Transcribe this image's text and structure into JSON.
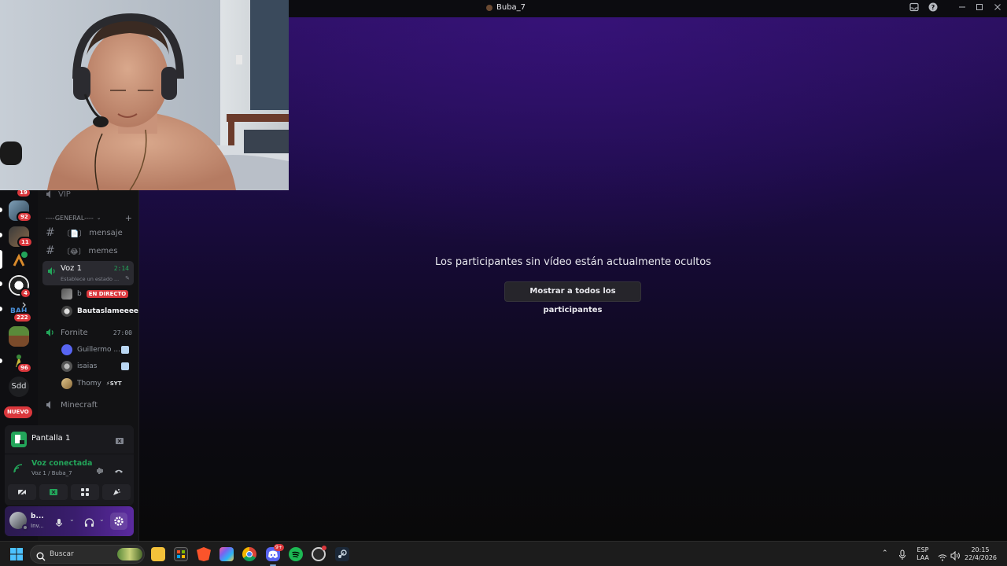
{
  "window": {
    "title": "Buba_7"
  },
  "stage": {
    "message": "Los participantes sin vídeo están actualmente ocultos",
    "show_all_button": "Mostrar a todos los participantes"
  },
  "servers": [
    {
      "badge": "19"
    },
    {
      "badge": "92"
    },
    {
      "badge": "11"
    },
    {
      "badge": ""
    },
    {
      "badge": "4"
    },
    {
      "badge": "222"
    },
    {
      "badge": ""
    },
    {
      "badge": "96"
    },
    {
      "label": "Sdd"
    },
    {
      "label": "NUEVO"
    }
  ],
  "channels": {
    "vip": "VIP",
    "category": "----GENERAL----",
    "text_channels": [
      {
        "name": "mensaje",
        "prefix": "〔📄〕"
      },
      {
        "name": "memes",
        "prefix": "〔😂〕"
      }
    ],
    "voz1": {
      "name": "Voz 1",
      "time": "2:14",
      "status": "Establece un estado ..."
    },
    "voz1_members": [
      {
        "name": "b",
        "live": "EN DIRECTO"
      },
      {
        "name": "Bautaslameeee"
      }
    ],
    "fornite": {
      "name": "Fornite",
      "time": "27:00"
    },
    "fornite_members": [
      {
        "name": "Guillermo ..."
      },
      {
        "name": "isaias"
      },
      {
        "name": "Thomy",
        "tag": "SYT"
      }
    ],
    "minecraft": "Minecraft"
  },
  "share_panel": {
    "title": "Pantalla 1"
  },
  "voice_panel": {
    "status": "Voz conectada",
    "location": "Voz 1 / Buba_7"
  },
  "user_panel": {
    "name": "b...",
    "status": "Inv..."
  },
  "taskbar": {
    "search_placeholder": "Buscar",
    "lang_top": "ESP",
    "lang_bottom": "LAA",
    "time": "20:15",
    "date": "22/4/2026",
    "discord_badge": "9+"
  },
  "colors": {
    "accent_green": "#23a55a",
    "live_red": "#da373c",
    "stage_purple": "#2b1060"
  }
}
